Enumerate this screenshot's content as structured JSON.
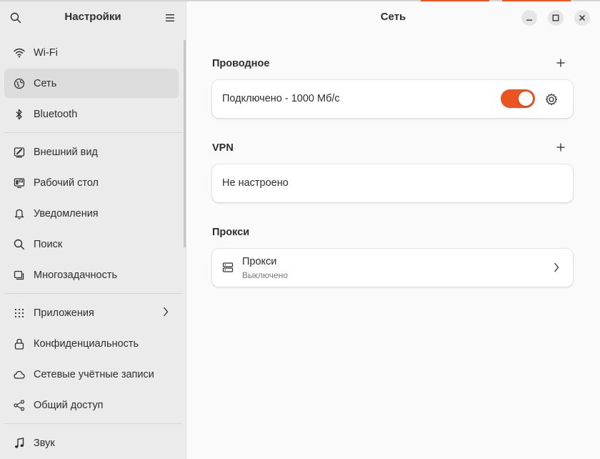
{
  "sidebar": {
    "title": "Настройки",
    "items": [
      {
        "label": "Wi-Fi",
        "icon": "wifi-icon"
      },
      {
        "label": "Сеть",
        "icon": "network-icon",
        "active": true
      },
      {
        "label": "Bluetooth",
        "icon": "bluetooth-icon"
      },
      {
        "label": "Внешний вид",
        "icon": "appearance-icon"
      },
      {
        "label": "Рабочий стол",
        "icon": "desktop-icon"
      },
      {
        "label": "Уведомления",
        "icon": "bell-icon"
      },
      {
        "label": "Поиск",
        "icon": "search-icon"
      },
      {
        "label": "Многозадачность",
        "icon": "multitasking-icon"
      },
      {
        "label": "Приложения",
        "icon": "apps-grid-icon"
      },
      {
        "label": "Конфиденциальность",
        "icon": "lock-icon"
      },
      {
        "label": "Сетевые учётные записи",
        "icon": "cloud-icon"
      },
      {
        "label": "Общий доступ",
        "icon": "share-icon"
      },
      {
        "label": "Звук",
        "icon": "music-note-icon"
      }
    ]
  },
  "main": {
    "title": "Сеть",
    "wired": {
      "title": "Проводное",
      "connection_label": "Подключено - 1000 Мб/с",
      "enabled": true
    },
    "vpn": {
      "title": "VPN",
      "status": "Не настроено"
    },
    "proxy": {
      "title": "Прокси",
      "row_label": "Прокси",
      "row_status": "Выключено"
    }
  },
  "colors": {
    "accent": "#e95420",
    "sidebar_bg": "#ebebeb",
    "main_bg": "#fafafa"
  }
}
